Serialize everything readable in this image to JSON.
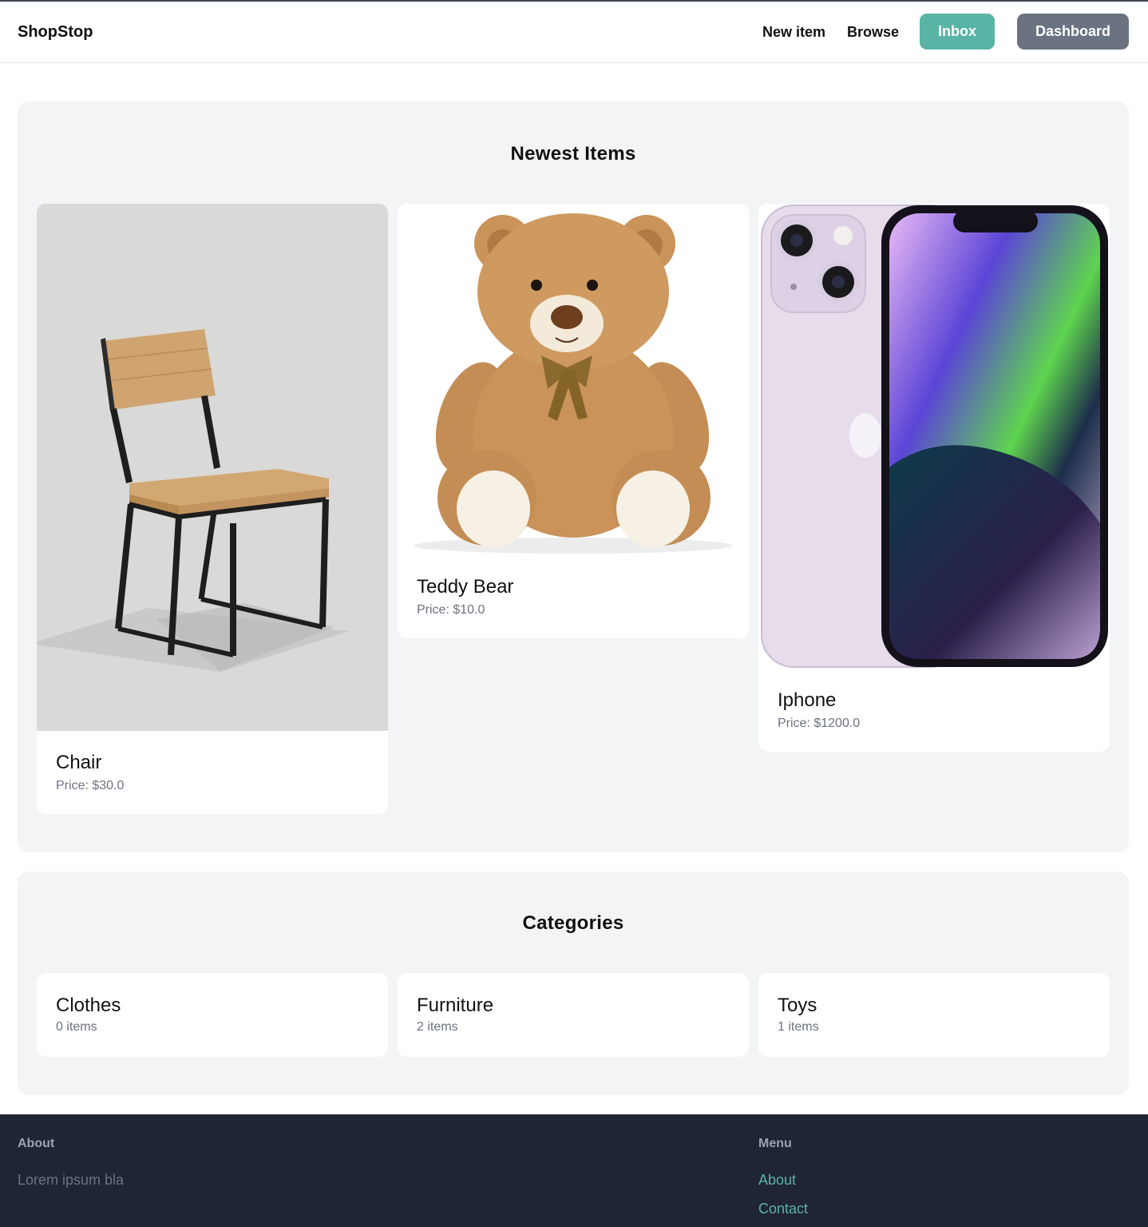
{
  "nav": {
    "brand": "ShopStop",
    "new_item": "New item",
    "browse": "Browse",
    "inbox": "Inbox",
    "dashboard": "Dashboard"
  },
  "newest": {
    "title": "Newest Items",
    "items": [
      {
        "name": "Chair",
        "price": "Price: $30.0"
      },
      {
        "name": "Teddy Bear",
        "price": "Price: $10.0"
      },
      {
        "name": "Iphone",
        "price": "Price: $1200.0"
      }
    ]
  },
  "categories": {
    "title": "Categories",
    "items": [
      {
        "name": "Clothes",
        "count": "0 items"
      },
      {
        "name": "Furniture",
        "count": "2 items"
      },
      {
        "name": "Toys",
        "count": "1 items"
      }
    ]
  },
  "footer": {
    "about_heading": "About",
    "about_text": "Lorem ipsum bla",
    "menu_heading": "Menu",
    "links": [
      "About",
      "Contact"
    ]
  },
  "colors": {
    "accent": "#5ab4a6",
    "secondary_button": "#6b7280",
    "footer_bg": "#1f2533",
    "section_bg": "#f3f4f6"
  }
}
